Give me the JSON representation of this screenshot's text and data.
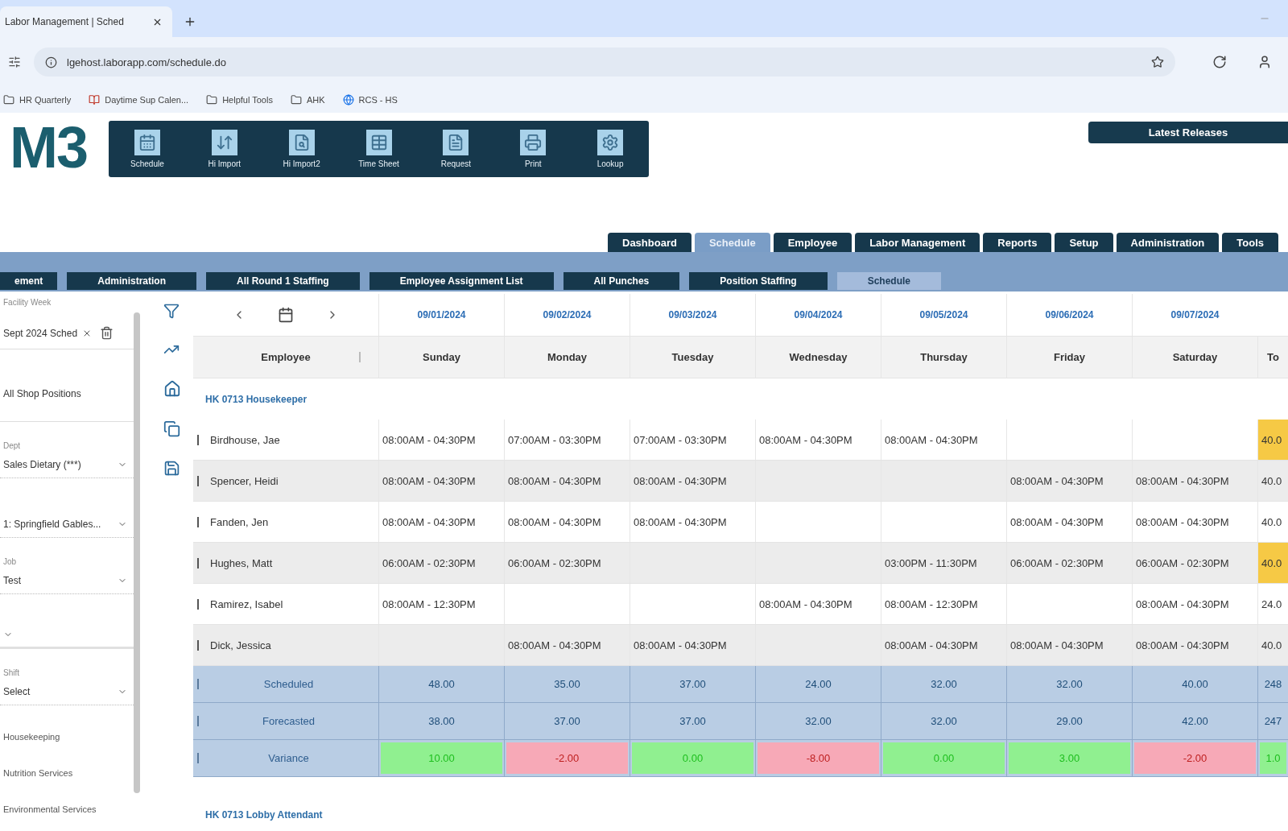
{
  "browser": {
    "tab_title": "Labor Management | Sched",
    "url": "lgehost.laborapp.com/schedule.do",
    "bookmarks": [
      {
        "label": "HR Quarterly",
        "kind": "folder"
      },
      {
        "label": "Daytime Sup Calen...",
        "kind": "page"
      },
      {
        "label": "Helpful Tools",
        "kind": "folder"
      },
      {
        "label": "AHK",
        "kind": "folder"
      },
      {
        "label": "RCS - HS",
        "kind": "site"
      }
    ]
  },
  "app": {
    "logo": "M3",
    "toolbar": [
      {
        "label": "Schedule",
        "kind": "calendar"
      },
      {
        "label": "Hi Import",
        "kind": "import"
      },
      {
        "label": "Hi Import2",
        "kind": "search"
      },
      {
        "label": "Time Sheet",
        "kind": "grid"
      },
      {
        "label": "Request",
        "kind": "document"
      },
      {
        "label": "Print",
        "kind": "print"
      },
      {
        "label": "Lookup",
        "kind": "settings"
      }
    ],
    "latest_releases": "Latest Releases"
  },
  "nav_tabs": [
    {
      "label": "Dashboard",
      "selected": false
    },
    {
      "label": "Schedule",
      "selected": true
    },
    {
      "label": "Employee",
      "selected": false
    },
    {
      "label": "Labor Management",
      "selected": false
    },
    {
      "label": "Reports",
      "selected": false
    },
    {
      "label": "Setup",
      "selected": false
    },
    {
      "label": "Administration",
      "selected": false
    },
    {
      "label": "Tools",
      "selected": false
    }
  ],
  "sub_tabs": [
    {
      "label": "ement",
      "selected": false
    },
    {
      "label": "Administration",
      "selected": false
    },
    {
      "label": "All Round 1 Staffing",
      "selected": false
    },
    {
      "label": "Employee Assignment List",
      "selected": false
    },
    {
      "label": "All Punches",
      "selected": false
    },
    {
      "label": "Position Staffing",
      "selected": false
    },
    {
      "label": "Schedule",
      "selected": true
    }
  ],
  "filters": [
    {
      "kind": "field",
      "label": "Facility Week",
      "value": "Sept 2024 Sched"
    },
    {
      "kind": "text",
      "value": "All Shop Positions"
    },
    {
      "kind": "select",
      "label": "Dept",
      "value": "Sales Dietary (***)"
    },
    {
      "kind": "select",
      "value": "1: Springfield Gables..."
    },
    {
      "kind": "select",
      "label": "Job",
      "value": "Test"
    },
    {
      "kind": "select"
    },
    {
      "kind": "select",
      "label": "Shift",
      "value": "Select"
    },
    {
      "kind": "item",
      "value": "Housekeeping"
    },
    {
      "kind": "item",
      "value": "Nutrition Services"
    },
    {
      "kind": "item",
      "value": "Environmental Services"
    }
  ],
  "schedule": {
    "week_dates": [
      "09/01/2024",
      "09/02/2024",
      "09/03/2024",
      "09/04/2024",
      "09/05/2024",
      "09/06/2024",
      "09/07/2024"
    ],
    "columns": [
      "Employee",
      "Sunday",
      "Monday",
      "Tuesday",
      "Wednesday",
      "Thursday",
      "Friday",
      "Saturday",
      "To"
    ],
    "groups": [
      {
        "title": "HK 0713 Housekeeper",
        "rows": [
          {
            "name": "Birdhouse, Jae",
            "sunday": "08:00AM - 04:30PM",
            "monday": "07:00AM - 03:30PM",
            "tuesday": "07:00AM - 03:30PM",
            "wednesday": "08:00AM - 04:30PM",
            "thursday": "08:00AM - 04:30PM",
            "column_9": {
              "text": "40.0",
              "flagged": true
            }
          },
          {
            "name": "Spencer, Heidi",
            "sunday": "08:00AM - 04:30PM",
            "monday": "08:00AM - 04:30PM",
            "tuesday": "08:00AM - 04:30PM",
            "friday": "08:00AM - 04:30PM",
            "saturday": "08:00AM - 04:30PM",
            "column_9": {
              "text": "40.0",
              "flagged": false
            }
          },
          {
            "name": "Fanden, Jen",
            "sunday": "08:00AM - 04:30PM",
            "monday": "08:00AM - 04:30PM",
            "tuesday": "08:00AM - 04:30PM",
            "friday": "08:00AM - 04:30PM",
            "saturday": "08:00AM - 04:30PM",
            "column_9": {
              "text": "40.0",
              "flagged": false
            }
          },
          {
            "name": "Hughes, Matt",
            "sunday": "06:00AM - 02:30PM",
            "monday": "06:00AM - 02:30PM",
            "thursday": "03:00PM - 11:30PM",
            "friday": "06:00AM - 02:30PM",
            "saturday": "06:00AM - 02:30PM",
            "column_9": {
              "text": "40.0",
              "flagged": true
            }
          },
          {
            "name": "Ramirez, Isabel",
            "sunday": "08:00AM - 12:30PM",
            "wednesday": "08:00AM - 04:30PM",
            "thursday": "08:00AM - 12:30PM",
            "saturday": "08:00AM - 04:30PM",
            "column_9": {
              "text": "24.0",
              "flagged": false
            }
          },
          {
            "name": "Dick, Jessica",
            "monday": "08:00AM - 04:30PM",
            "tuesday": "08:00AM - 04:30PM",
            "thursday": "08:00AM - 04:30PM",
            "friday": "08:00AM - 04:30PM",
            "saturday": "08:00AM - 04:30PM",
            "column_9": {
              "text": "40.0",
              "flagged": false
            }
          }
        ],
        "summary": [
          {
            "kind": "hours",
            "label": "Scheduled",
            "cells": [
              "48.00",
              "35.00",
              "37.00",
              "24.00",
              "32.00",
              "32.00",
              "40.00",
              "248"
            ]
          },
          {
            "kind": "hours",
            "label": "Forecasted",
            "cells": [
              "38.00",
              "37.00",
              "37.00",
              "32.00",
              "32.00",
              "29.00",
              "42.00",
              "247"
            ]
          },
          {
            "kind": "variance",
            "label": "Variance",
            "cells": [
              {
                "text": "10.00",
                "color": "#90f090"
              },
              {
                "text": "-2.00",
                "color": "#f7a9b7"
              },
              {
                "text": "0.00",
                "color": "#90f090"
              },
              {
                "text": "-8.00",
                "color": "#f7a9b7"
              },
              {
                "text": "0.00",
                "color": "#90f090"
              },
              {
                "text": "3.00",
                "color": "#90f090"
              },
              {
                "text": "-2.00",
                "color": "#f7a9b7"
              },
              {
                "text": "1.0",
                "color": "#90f090"
              }
            ]
          }
        ]
      },
      {
        "title": "HK 0713 Lobby Attendant"
      }
    ]
  }
}
